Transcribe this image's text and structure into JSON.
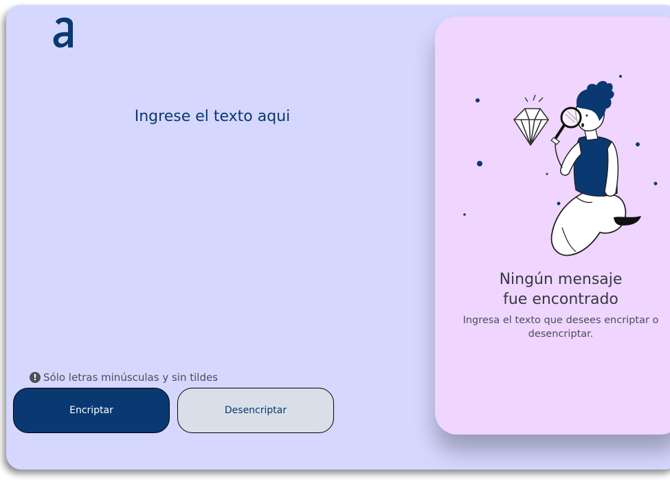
{
  "app": {
    "logo": "alura-logo"
  },
  "input": {
    "placeholder": "Ingrese el texto aqui",
    "value": ""
  },
  "hint": {
    "icon": "exclamation-circle-icon",
    "text": "Sólo letras minúsculas y sin tildes"
  },
  "buttons": {
    "encrypt_label": "Encriptar",
    "decrypt_label": "Desencriptar"
  },
  "output_panel": {
    "illustration": "person-with-magnifier-and-diamond",
    "title": "Ningún mensaje\nfue encontrado",
    "description": "Ingresa el texto que desees encriptar o desencriptar."
  },
  "colors": {
    "background": "#d5d7ff",
    "panel": "#f0d5ff",
    "primary": "#0a3871",
    "secondary_button": "#d8dfe8"
  }
}
